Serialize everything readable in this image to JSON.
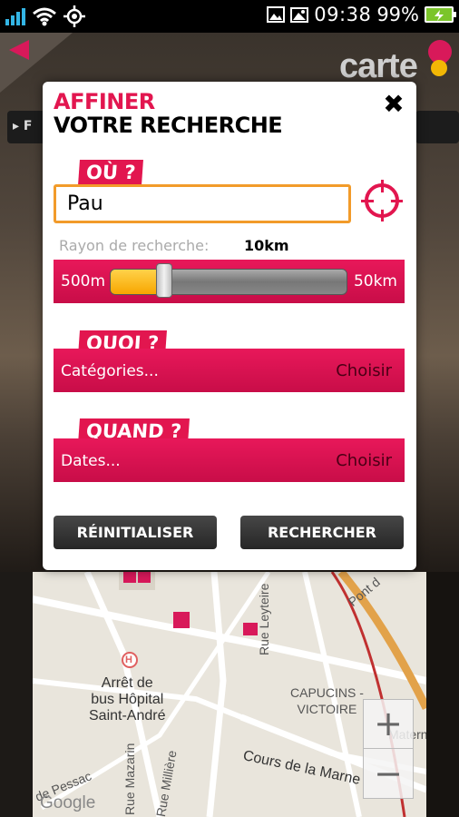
{
  "status_bar": {
    "time": "09:38",
    "battery_percent": "99%",
    "icons": [
      "signal-icon",
      "wifi-icon",
      "gps-icon",
      "image-notification-icon",
      "gallery-notification-icon",
      "battery-charging-icon"
    ]
  },
  "background": {
    "logo": "carte",
    "filter_tab": "▸ F",
    "map": {
      "labels": {
        "arret": "Arrêt de\nbus Hôpital\nSaint-André",
        "capucins": "CAPUCINS -\nVICTOIRE",
        "cours_marne": "Cours de la Marne",
        "rue_leyteire": "Rue Leyteire",
        "rue_mazarin": "Rue Mazarin",
        "rue_milliere": "Rue Millière",
        "pessac": "de Pessac",
        "pont": "Pont d",
        "matern": "Matern",
        "hospital_marker": "H"
      },
      "zoom_in": "+",
      "zoom_out": "−",
      "attribution": "Google"
    }
  },
  "dialog": {
    "title_line1": "AFFINER",
    "title_line2": "VOTRE RECHERCHE",
    "close": "✖",
    "where_tag": "OÙ ?",
    "location_value": "Pau",
    "radius_label": "Rayon de recherche:",
    "radius_value": "10km",
    "slider": {
      "min_label": "500m",
      "max_label": "50km",
      "fill_fraction": 0.23
    },
    "what_tag": "QUOI ?",
    "categories_label": "Catégories...",
    "categories_action": "Choisir",
    "when_tag": "QUAND ?",
    "dates_label": "Dates...",
    "dates_action": "Choisir",
    "reset_button": "RÉINITIALISER",
    "search_button": "RECHERCHER"
  },
  "colors": {
    "accent": "#e2164f",
    "input_border": "#f29b2a",
    "slider_fill": "#f7a600",
    "button_dark": "#262626"
  }
}
